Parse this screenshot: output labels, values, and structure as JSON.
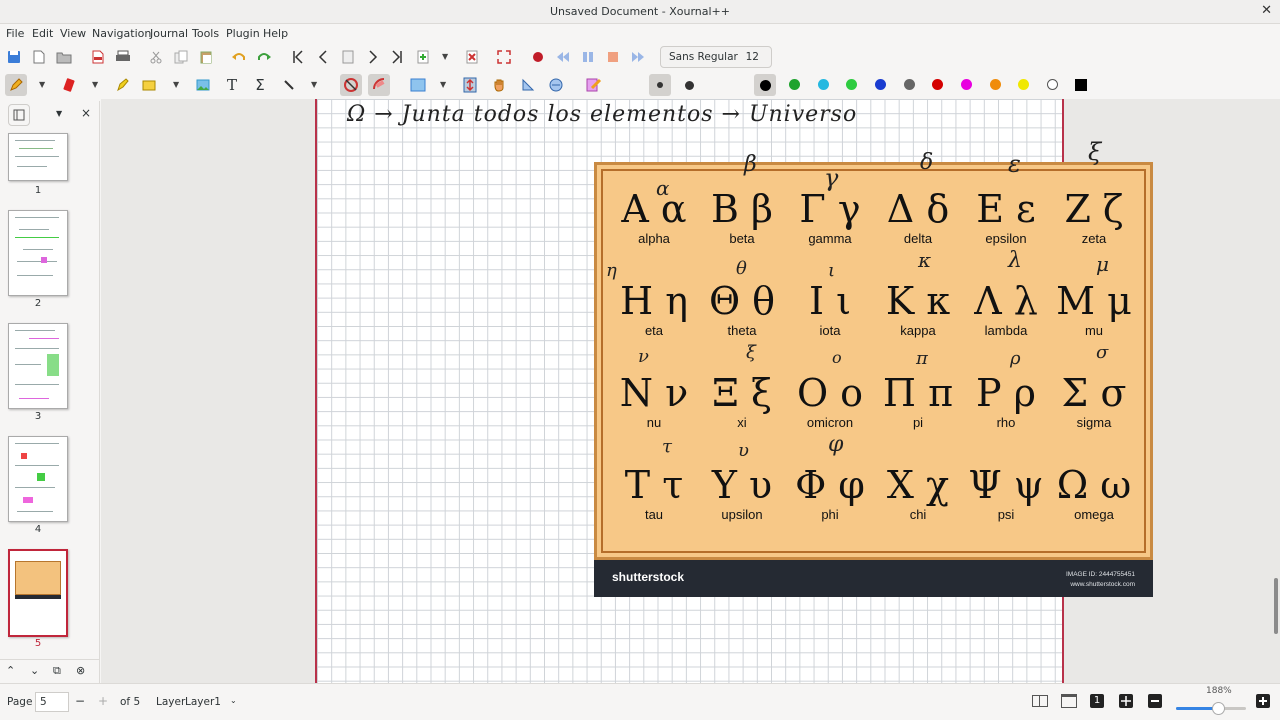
{
  "window": {
    "title": "Unsaved Document - Xournal++"
  },
  "menu": [
    "File",
    "Edit",
    "View",
    "Navigation",
    "Journal",
    "Tools",
    "Plugin",
    "Help"
  ],
  "toolbar": {
    "font_name": "Sans Regular",
    "font_size": "12"
  },
  "colors": {
    "accent": "#c0263b",
    "palette": [
      "#000000",
      "#1fa32e",
      "#25b8e0",
      "#2ecc40",
      "#1a3cd0",
      "#666666",
      "#d40000",
      "#e800e0",
      "#f08c0a",
      "#f0e800",
      "#ffffff"
    ]
  },
  "sidebar": {
    "pages": [
      {
        "number": "1"
      },
      {
        "number": "2"
      },
      {
        "number": "3"
      },
      {
        "number": "4"
      },
      {
        "number": "5"
      }
    ]
  },
  "handwriting": {
    "header": "Ω → Junta todos los elementos → Universo",
    "annotations": [
      "α",
      "β",
      "γ",
      "δ",
      "ε",
      "ξ",
      "η",
      "θ",
      "ι",
      "κ",
      "λ",
      "μ",
      "ν",
      "ξ",
      "ο",
      "π",
      "ρ",
      "σ",
      "τ",
      "υ",
      "φ"
    ]
  },
  "greek_chart": {
    "letters": [
      {
        "glyph": "Α α",
        "name": "alpha"
      },
      {
        "glyph": "Β β",
        "name": "beta"
      },
      {
        "glyph": "Γ γ",
        "name": "gamma"
      },
      {
        "glyph": "Δ δ",
        "name": "delta"
      },
      {
        "glyph": "Ε ε",
        "name": "epsilon"
      },
      {
        "glyph": "Ζ ζ",
        "name": "zeta"
      },
      {
        "glyph": "Η η",
        "name": "eta"
      },
      {
        "glyph": "Θ θ",
        "name": "theta"
      },
      {
        "glyph": "Ι ι",
        "name": "iota"
      },
      {
        "glyph": "Κ κ",
        "name": "kappa"
      },
      {
        "glyph": "Λ λ",
        "name": "lambda"
      },
      {
        "glyph": "Μ μ",
        "name": "mu"
      },
      {
        "glyph": "Ν ν",
        "name": "nu"
      },
      {
        "glyph": "Ξ ξ",
        "name": "xi"
      },
      {
        "glyph": "Ο ο",
        "name": "omicron"
      },
      {
        "glyph": "Π π",
        "name": "pi"
      },
      {
        "glyph": "Ρ ρ",
        "name": "rho"
      },
      {
        "glyph": "Σ σ",
        "name": "sigma"
      },
      {
        "glyph": "Τ τ",
        "name": "tau"
      },
      {
        "glyph": "Υ υ",
        "name": "upsilon"
      },
      {
        "glyph": "Φ φ",
        "name": "phi"
      },
      {
        "glyph": "Χ χ",
        "name": "chi"
      },
      {
        "glyph": "Ψ ψ",
        "name": "psi"
      },
      {
        "glyph": "Ω ω",
        "name": "omega"
      }
    ],
    "footer_brand": "shutterstock",
    "footer_id": "IMAGE ID: 2444755451",
    "footer_url": "www.shutterstock.com"
  },
  "status": {
    "page_label": "Page",
    "page_value": "5",
    "page_of": "of 5",
    "layer_label": "Layer",
    "layer_value": "Layer1",
    "zoom": "188%"
  }
}
